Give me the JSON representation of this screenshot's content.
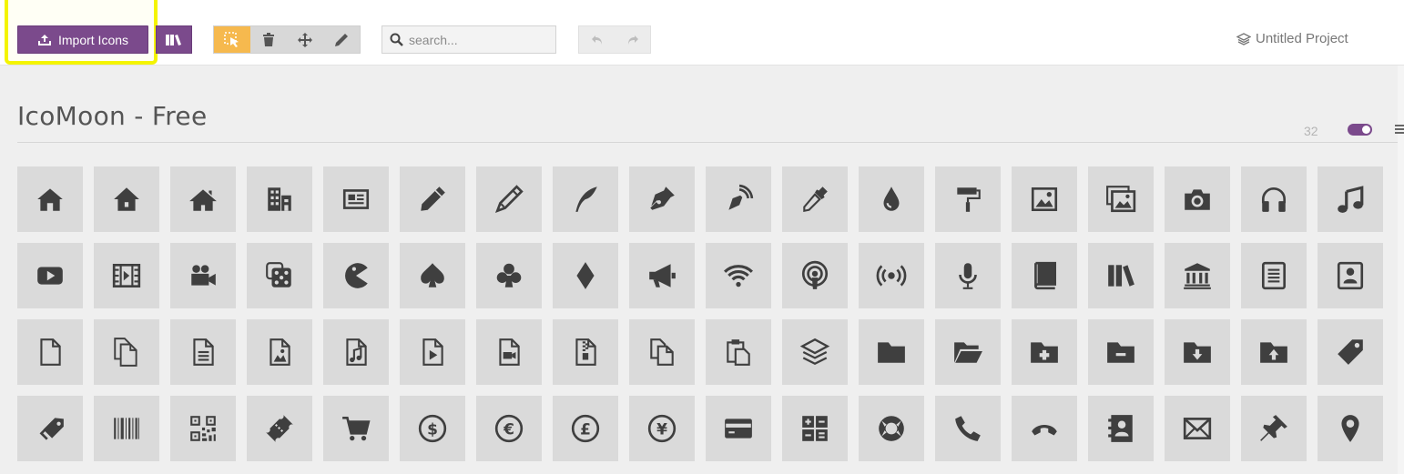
{
  "toolbar": {
    "import_label": "Import Icons",
    "search_placeholder": "search...",
    "project_name": "Untitled Project",
    "highlight_color": "#f4f400",
    "brand_color": "#7b4a8c",
    "active_tool_color": "#f6b94e"
  },
  "set": {
    "title": "IcoMoon - Free",
    "count": "32"
  },
  "icons": [
    "home-icon",
    "home2-icon",
    "home3-icon",
    "office-icon",
    "newspaper-icon",
    "pencil-icon",
    "pencil2-icon",
    "quill-icon",
    "pen-icon",
    "blog-icon",
    "eyedropper-icon",
    "droplet-icon",
    "paint-format-icon",
    "image-icon",
    "images-icon",
    "camera-icon",
    "headphones-icon",
    "music-icon",
    "play-icon",
    "film-icon",
    "video-camera-icon",
    "dice-icon",
    "pacman-icon",
    "spades-icon",
    "clubs-icon",
    "diamonds-icon",
    "bullhorn-icon",
    "connection-icon",
    "podcast-icon",
    "feed-icon",
    "mic-icon",
    "book-icon",
    "books-icon",
    "library-icon",
    "file-text-icon",
    "profile-icon",
    "file-empty-icon",
    "files-empty-icon",
    "file-text2-icon",
    "file-picture-icon",
    "file-music-icon",
    "file-play-icon",
    "file-video-icon",
    "file-zip-icon",
    "copy-icon",
    "paste-icon",
    "stack-icon",
    "folder-icon",
    "folder-open-icon",
    "folder-plus-icon",
    "folder-minus-icon",
    "folder-download-icon",
    "folder-upload-icon",
    "price-tag-icon",
    "price-tags-icon",
    "barcode-icon",
    "qrcode-icon",
    "ticket-icon",
    "cart-icon",
    "coin-dollar-icon",
    "coin-euro-icon",
    "coin-pound-icon",
    "coin-yen-icon",
    "credit-card-icon",
    "calculator-icon",
    "lifebuoy-icon",
    "phone-icon",
    "phone-hang-up-icon",
    "address-book-icon",
    "envelop-icon",
    "pushpin-icon",
    "location-icon"
  ]
}
